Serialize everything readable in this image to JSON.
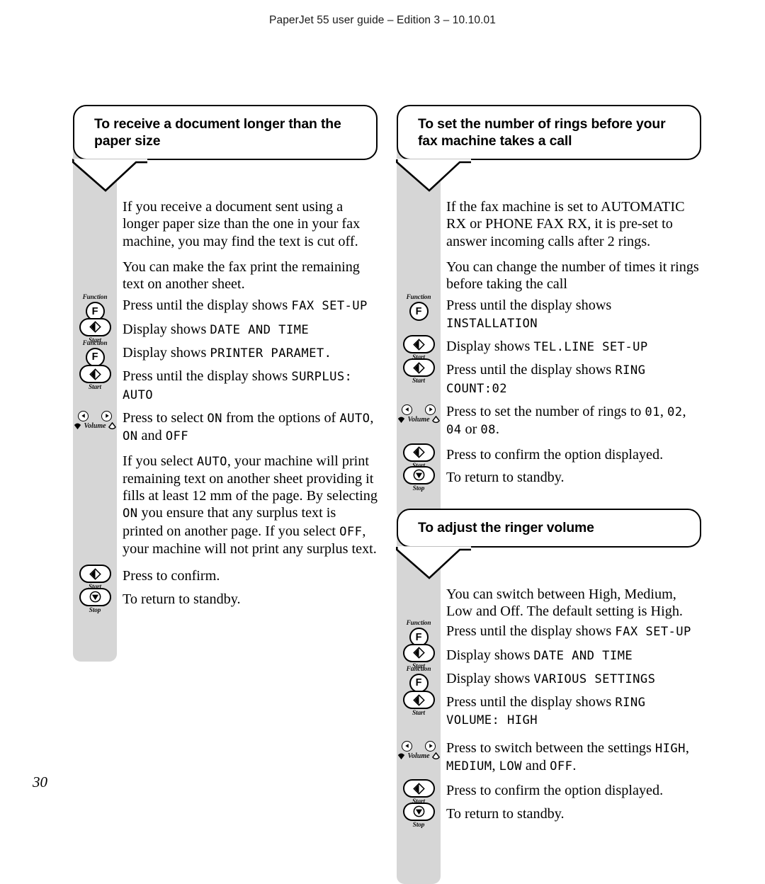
{
  "header": {
    "running_head": "PaperJet 55 user guide – Edition 3 – 10.10.01"
  },
  "folio": {
    "page_number": "30"
  },
  "icons": {
    "function_caption": "Function",
    "function_glyph": "F",
    "start_caption": "Start",
    "stop_caption": "Stop",
    "volume_caption": "Volume"
  },
  "sections": [
    {
      "id": "receive-long-document",
      "heading": "To receive a document longer than the paper size",
      "intro": [
        "If you receive a document sent using a longer paper size than the one in your fax machine, you may find the text is cut off.",
        "You can make the fax print the remaining text on another sheet."
      ],
      "steps": [
        {
          "key": "function",
          "text_before": "Press until the display shows ",
          "lcd": "FAX SET-UP",
          "text_after": ""
        },
        {
          "key": "start",
          "text_before": "Display shows ",
          "lcd": "DATE AND TIME",
          "text_after": ""
        },
        {
          "key": "function",
          "text_before": "Display shows ",
          "lcd": "PRINTER PARAMET.",
          "text_after": ""
        },
        {
          "key": "start",
          "text_before": "Press until the display shows ",
          "lcd": "SURPLUS: AUTO",
          "text_after": ""
        },
        {
          "key": "volume",
          "text_before": "Press to select ",
          "lcd": "ON",
          "text_after": " from the options of ",
          "lcd2": "AUTO",
          "text_after2": ", ",
          "lcd3": "ON",
          "text_after3": " and ",
          "lcd4": "OFF"
        }
      ],
      "explain_parts": [
        {
          "t": "If you select "
        },
        {
          "lcd": "AUTO"
        },
        {
          "t": ", your machine will print remaining text on another sheet providing it fills at least 12 mm of the page. By selecting "
        },
        {
          "lcd": "ON"
        },
        {
          "t": " you ensure that any surplus text is printed on another page. If you select "
        },
        {
          "lcd": "OFF"
        },
        {
          "t": ", your machine will not print any surplus text."
        }
      ],
      "closing_steps": [
        {
          "key": "start",
          "text": "Press to confirm."
        },
        {
          "key": "stop",
          "text": "To return to standby."
        }
      ]
    },
    {
      "id": "set-ring-count",
      "heading": "To set the number of rings before your fax machine takes a call",
      "intro": [
        "If the fax machine is set to AUTOMATIC RX or PHONE FAX RX, it is pre-set to answer incoming calls after 2 rings.",
        "You can change the number of times it rings before taking the call"
      ],
      "steps": [
        {
          "key": "function",
          "text_before": "Press until the display shows ",
          "lcd": "INSTALLATION",
          "text_after": ""
        },
        {
          "key": "start",
          "text_before": "Display shows ",
          "lcd": "TEL.LINE SET-UP",
          "text_after": ""
        },
        {
          "key": "start",
          "text_before": "Press until the display shows ",
          "lcd": "RING COUNT:02",
          "text_after": ""
        },
        {
          "key": "volume",
          "text_before": "Press to set the number of rings to ",
          "lcd": "01",
          "text_after": ", ",
          "lcd2": "02",
          "text_after2": ", ",
          "lcd3": "04",
          "text_after3": " or ",
          "lcd4": "08",
          "text_after4": "."
        }
      ],
      "closing_steps": [
        {
          "key": "start",
          "text": "Press to confirm the option displayed."
        },
        {
          "key": "stop",
          "text": "To return to standby."
        }
      ]
    },
    {
      "id": "adjust-ringer-volume",
      "heading": "To adjust the ringer volume",
      "intro": [
        "You can switch between High, Medium, Low and Off. The default setting is High."
      ],
      "steps": [
        {
          "key": "function",
          "text_before": "Press until the display shows  ",
          "lcd": "FAX SET-UP",
          "text_after": ""
        },
        {
          "key": "start",
          "text_before": "Display shows ",
          "lcd": "DATE AND TIME",
          "text_after": ""
        },
        {
          "key": "function",
          "text_before": "Display shows ",
          "lcd": "VARIOUS SETTINGS",
          "text_after": ""
        },
        {
          "key": "start",
          "text_before": "Press until the display shows ",
          "lcd": "RING VOLUME: HIGH",
          "text_after": ""
        },
        {
          "key": "volume",
          "text_before": "Press to switch between the settings ",
          "lcd": "HIGH",
          "text_after": ", ",
          "lcd2": "MEDIUM",
          "text_after2": ", ",
          "lcd3": "LOW",
          "text_after3": " and ",
          "lcd4": "OFF",
          "text_after4": "."
        }
      ],
      "closing_steps": [
        {
          "key": "start",
          "text": "Press to confirm the option displayed."
        },
        {
          "key": "stop",
          "text": "To return to standby."
        }
      ]
    }
  ],
  "colors": {
    "strip": "#d6d6d6",
    "ink": "#000000"
  }
}
